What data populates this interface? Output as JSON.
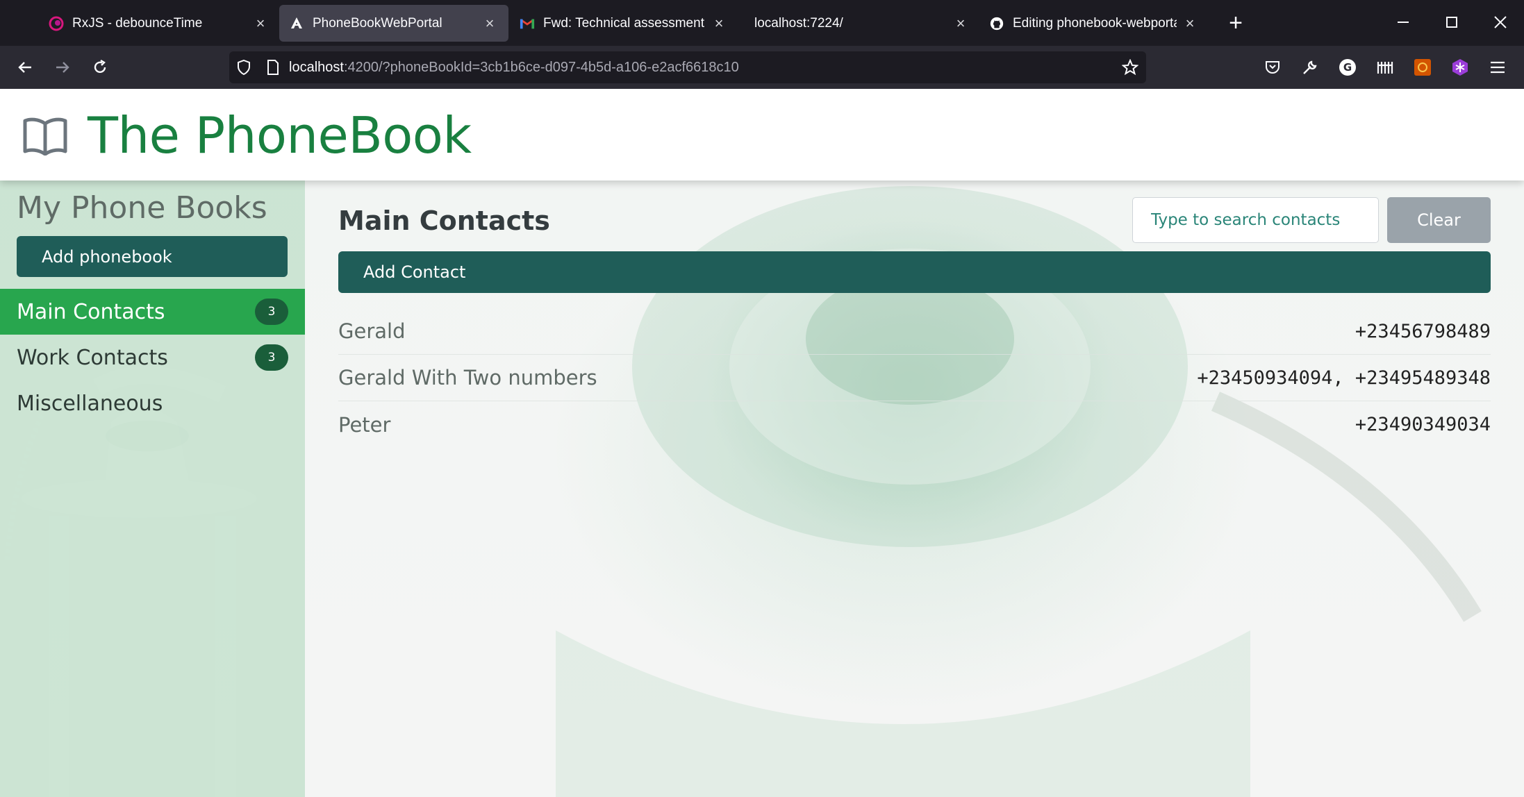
{
  "browser": {
    "tabs": [
      {
        "title": "RxJS - debounceTime",
        "icon": "rxjs-icon",
        "active": false
      },
      {
        "title": "PhoneBookWebPortal",
        "icon": "angular-icon",
        "active": true
      },
      {
        "title": "Fwd: Technical assessment Gera",
        "icon": "gmail-icon",
        "active": false
      },
      {
        "title": "localhost:7224/",
        "icon": "",
        "active": false
      },
      {
        "title": "Editing phonebook-webportal/",
        "icon": "github-icon",
        "active": false
      }
    ],
    "url_host": "localhost",
    "url_rest": ":4200/?phoneBookId=3cb1b6ce-d097-4b5d-a106-e2acf6618c10"
  },
  "app": {
    "brand_title": "The PhoneBook"
  },
  "sidebar": {
    "heading": "My Phone Books",
    "add_label": "Add phonebook",
    "items": [
      {
        "label": "Main Contacts",
        "count": "3",
        "active": true
      },
      {
        "label": "Work Contacts",
        "count": "3",
        "active": false
      },
      {
        "label": "Miscellaneous",
        "count": "",
        "active": false
      }
    ]
  },
  "main": {
    "title": "Main Contacts",
    "search_placeholder": "Type to search contacts",
    "clear_label": "Clear",
    "add_contact_label": "Add Contact",
    "contacts": [
      {
        "name": "Gerald",
        "numbers": "+23456798489"
      },
      {
        "name": "Gerald With Two numbers",
        "numbers": "+23450934094, +23495489348"
      },
      {
        "name": "Peter",
        "numbers": "+23490349034"
      }
    ]
  },
  "colors": {
    "brand_green": "#198040",
    "active_item": "#28a64e",
    "primary_button": "#1f5d58",
    "badge": "#1a5e3a"
  }
}
